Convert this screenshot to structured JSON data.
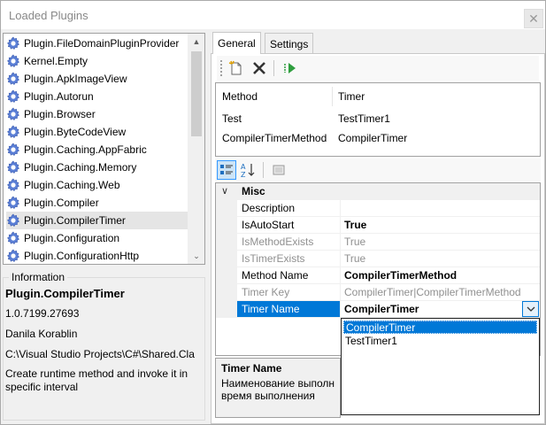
{
  "window": {
    "title": "Loaded Plugins",
    "close_glyph": "✕"
  },
  "plugins": [
    "Plugin.FileDomainPluginProvider",
    "Kernel.Empty",
    "Plugin.ApkImageView",
    "Plugin.Autorun",
    "Plugin.Browser",
    "Plugin.ByteCodeView",
    "Plugin.Caching.AppFabric",
    "Plugin.Caching.Memory",
    "Plugin.Caching.Web",
    "Plugin.Compiler",
    "Plugin.CompilerTimer",
    "Plugin.Configuration",
    "Plugin.ConfigurationHttp"
  ],
  "selected_plugin_index": 10,
  "information": {
    "legend": "Information",
    "name": "Plugin.CompilerTimer",
    "version": "1.0.7199.27693",
    "author": "Danila Korablin",
    "path": "C:\\Visual Studio Projects\\C#\\Shared.Cla",
    "description": "Create runtime method and invoke it in specific interval"
  },
  "tabs": [
    {
      "label": "General",
      "active": true
    },
    {
      "label": "Settings",
      "active": false
    }
  ],
  "method_list": {
    "columns": [
      "Method",
      "Timer"
    ],
    "rows": [
      [
        "Test",
        "TestTimer1"
      ],
      [
        "CompilerTimerMethod",
        "CompilerTimer"
      ]
    ]
  },
  "property_grid": {
    "category": "Misc",
    "rows": [
      {
        "name": "Description",
        "value": "",
        "muted": false,
        "bold": false
      },
      {
        "name": "IsAutoStart",
        "value": "True",
        "muted": false,
        "bold": true
      },
      {
        "name": "IsMethodExists",
        "value": "True",
        "muted": true,
        "bold": false
      },
      {
        "name": "IsTimerExists",
        "value": "True",
        "muted": true,
        "bold": false
      },
      {
        "name": "Method Name",
        "value": "CompilerTimerMethod",
        "muted": false,
        "bold": true
      },
      {
        "name": "Timer Key",
        "value": "CompilerTimer|CompilerTimerMethod",
        "muted": true,
        "bold": false
      },
      {
        "name": "Timer Name",
        "value": "CompilerTimer",
        "muted": false,
        "bold": true,
        "selected": true
      }
    ],
    "dropdown_options": [
      "CompilerTimer",
      "TestTimer1"
    ],
    "dropdown_selected_index": 0
  },
  "help": {
    "title": "Timer Name",
    "description": "Наименование выполн... время выполнения",
    "description_line1": "Наименование выполн",
    "description_line2": "время выполнения"
  },
  "colors": {
    "selection": "#0078d7",
    "accent_green": "#2e9e3e",
    "delete_dark": "#333333"
  }
}
